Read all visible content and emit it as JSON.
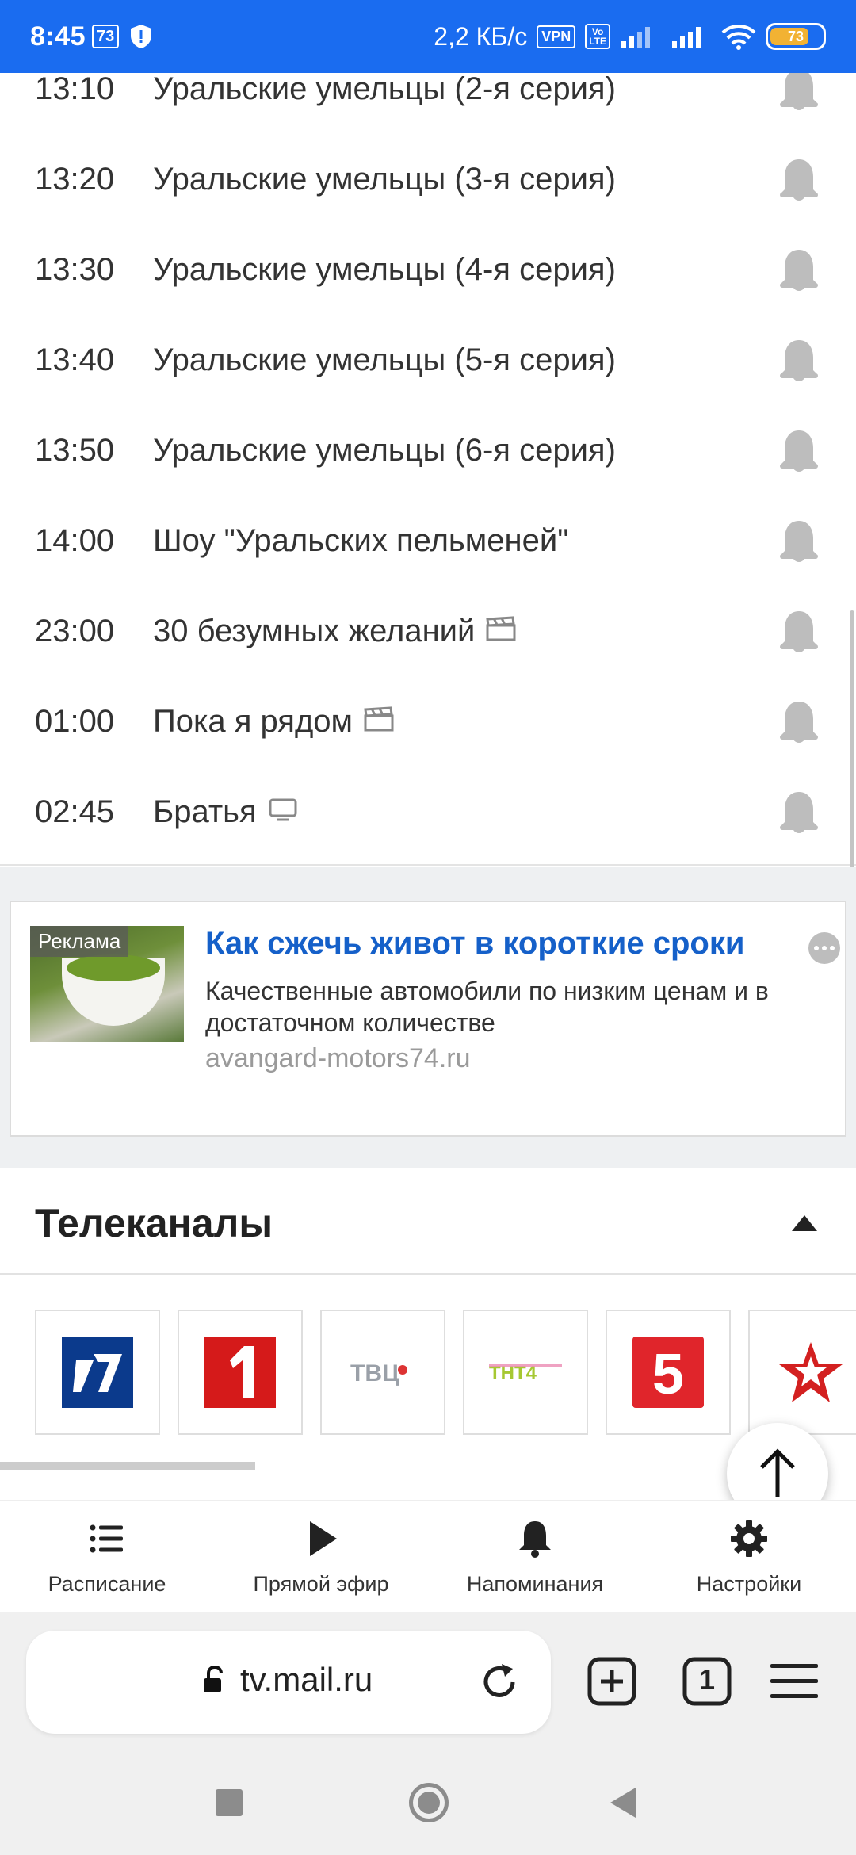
{
  "status_bar": {
    "time": "8:45",
    "notif_count": "73",
    "speed": "2,2 КБ/с",
    "vpn": "VPN",
    "volte_top": "Vo",
    "volte_bottom": "LTE",
    "battery": "73"
  },
  "schedule": [
    {
      "time": "13:10",
      "title": "Уральские умельцы (2-я серия)",
      "genre_icon": ""
    },
    {
      "time": "13:20",
      "title": "Уральские умельцы (3-я серия)",
      "genre_icon": ""
    },
    {
      "time": "13:30",
      "title": "Уральские умельцы (4-я серия)",
      "genre_icon": ""
    },
    {
      "time": "13:40",
      "title": "Уральские умельцы (5-я серия)",
      "genre_icon": ""
    },
    {
      "time": "13:50",
      "title": "Уральские умельцы (6-я серия)",
      "genre_icon": ""
    },
    {
      "time": "14:00",
      "title": "Шоу \"Уральских пельменей\"",
      "genre_icon": ""
    },
    {
      "time": "23:00",
      "title": "30 безумных желаний",
      "genre_icon": "clapperboard-icon"
    },
    {
      "time": "01:00",
      "title": "Пока я рядом",
      "genre_icon": "clapperboard-icon"
    },
    {
      "time": "02:45",
      "title": "Братья",
      "genre_icon": "tv-icon"
    }
  ],
  "ad": {
    "label": "Реклама",
    "title": "Как сжечь живот в короткие сроки",
    "description": "Качественные автомобили по низким ценам и в достаточном количестве",
    "domain": "avangard-motors74.ru"
  },
  "channels": {
    "title": "Телеканалы",
    "items": [
      {
        "name": "Первый канал",
        "icon": "channel1-logo"
      },
      {
        "name": "Россия 1",
        "icon": "russia1-logo"
      },
      {
        "name": "ТВЦ",
        "icon": "tvc-logo"
      },
      {
        "name": "ТНТ4",
        "icon": "tnt4-logo"
      },
      {
        "name": "Пятый канал",
        "icon": "channel5-logo"
      },
      {
        "name": "Звезда",
        "icon": "zvezda-logo"
      }
    ]
  },
  "bottom_nav": {
    "schedule": "Расписание",
    "live": "Прямой эфир",
    "reminders": "Напоминания",
    "settings": "Настройки"
  },
  "browser": {
    "url": "tv.mail.ru",
    "tab_count": "1"
  },
  "colors": {
    "status_bar": "#1a6cf0",
    "ad_title": "#1560c9",
    "channel1": "#0b3a8c",
    "russia1": "#d51a1a",
    "channel5": "#e0252b",
    "zvezda": "#d32020"
  }
}
